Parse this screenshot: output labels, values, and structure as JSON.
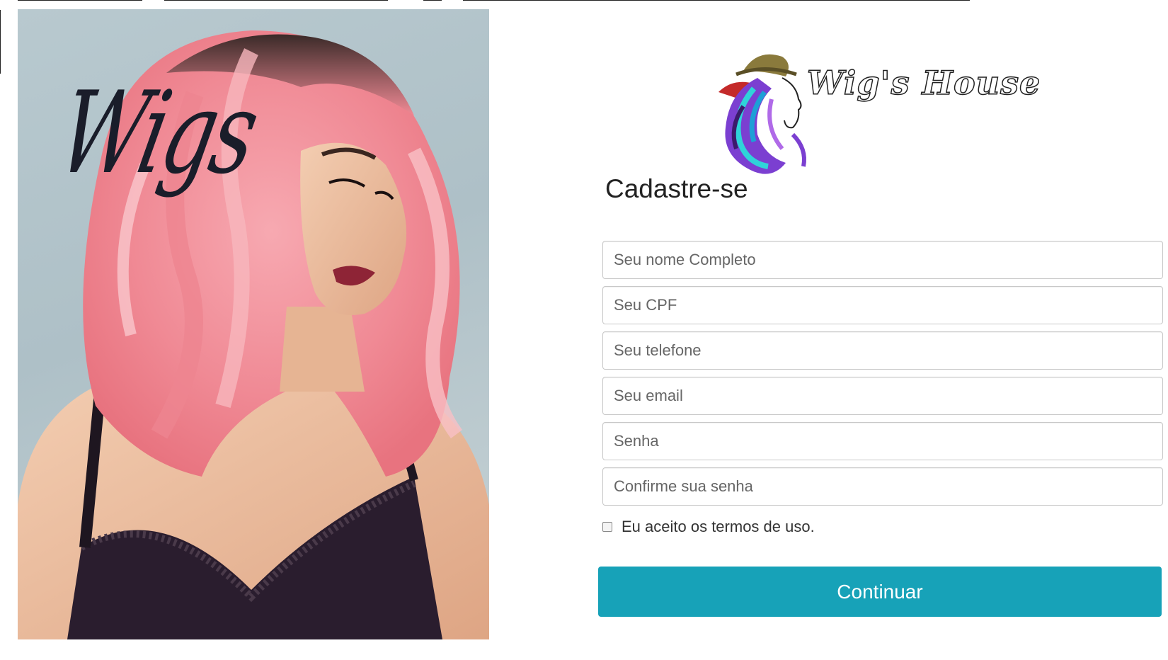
{
  "hero": {
    "script_text": "Wigs"
  },
  "brand": {
    "logo_text": "Wig's House"
  },
  "form": {
    "title": "Cadastre-se",
    "fields": [
      {
        "placeholder": "Seu nome Completo",
        "value": ""
      },
      {
        "placeholder": "Seu CPF",
        "value": ""
      },
      {
        "placeholder": "Seu telefone",
        "value": ""
      },
      {
        "placeholder": "Seu email",
        "value": ""
      },
      {
        "placeholder": "Senha",
        "value": ""
      },
      {
        "placeholder": "Confirme sua senha",
        "value": ""
      }
    ],
    "terms_label": "Eu aceito os termos de uso.",
    "terms_checked": false,
    "submit_label": "Continuar"
  },
  "colors": {
    "accent": "#17a2b8",
    "hair": "#f28a94",
    "background": "#ffffff"
  }
}
